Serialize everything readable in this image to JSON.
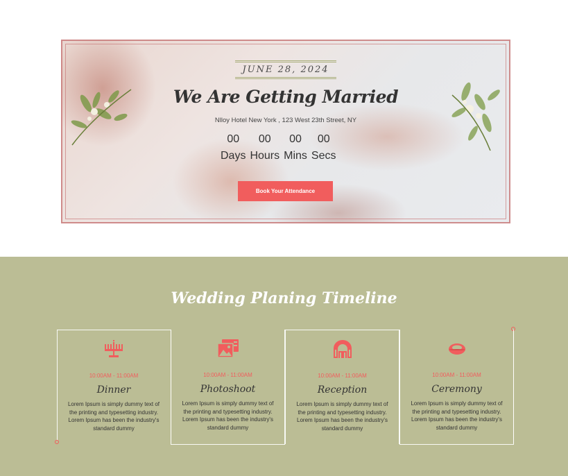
{
  "hero": {
    "date": "JUNE 28, 2024",
    "headline": "We Are Getting Married",
    "address": "Nlloy Hotel New York , 123 West 23th Street, NY",
    "countdown": [
      {
        "value": "00",
        "label": "Days"
      },
      {
        "value": "00",
        "label": "Hours"
      },
      {
        "value": "00",
        "label": "Mins"
      },
      {
        "value": "00",
        "label": "Secs"
      }
    ],
    "cta_label": "Book Your Attendance"
  },
  "timeline": {
    "title": "Wedding Planing Timeline",
    "items": [
      {
        "icon": "menorah-icon",
        "time": "10:00AM - 11:00AM",
        "title": "Dinner",
        "text": "Lorem Ipsum is simply dummy text of the printing and typesetting industry. Lorem Ipsum has been the industry's standard dummy"
      },
      {
        "icon": "photo-gallery-icon",
        "time": "10:00AM - 11:00AM",
        "title": "Photoshoot",
        "text": "Lorem Ipsum is simply dummy text of the printing and typesetting industry. Lorem Ipsum has been the industry's standard dummy"
      },
      {
        "icon": "arch-gate-icon",
        "time": "10:00AM - 11:00AM",
        "title": "Reception",
        "text": "Lorem Ipsum is simply dummy text of the printing and typesetting industry. Lorem Ipsum has been the industry's standard dummy"
      },
      {
        "icon": "ring-icon",
        "time": "10:00AM - 11:00AM",
        "title": "Ceremony",
        "text": "Lorem Ipsum is simply dummy text of the printing and typesetting industry. Lorem Ipsum has been the industry's standard dummy"
      }
    ]
  },
  "colors": {
    "accent": "#f15d5d",
    "section_bg": "#bbbd95",
    "frame": "#c97b7b"
  }
}
